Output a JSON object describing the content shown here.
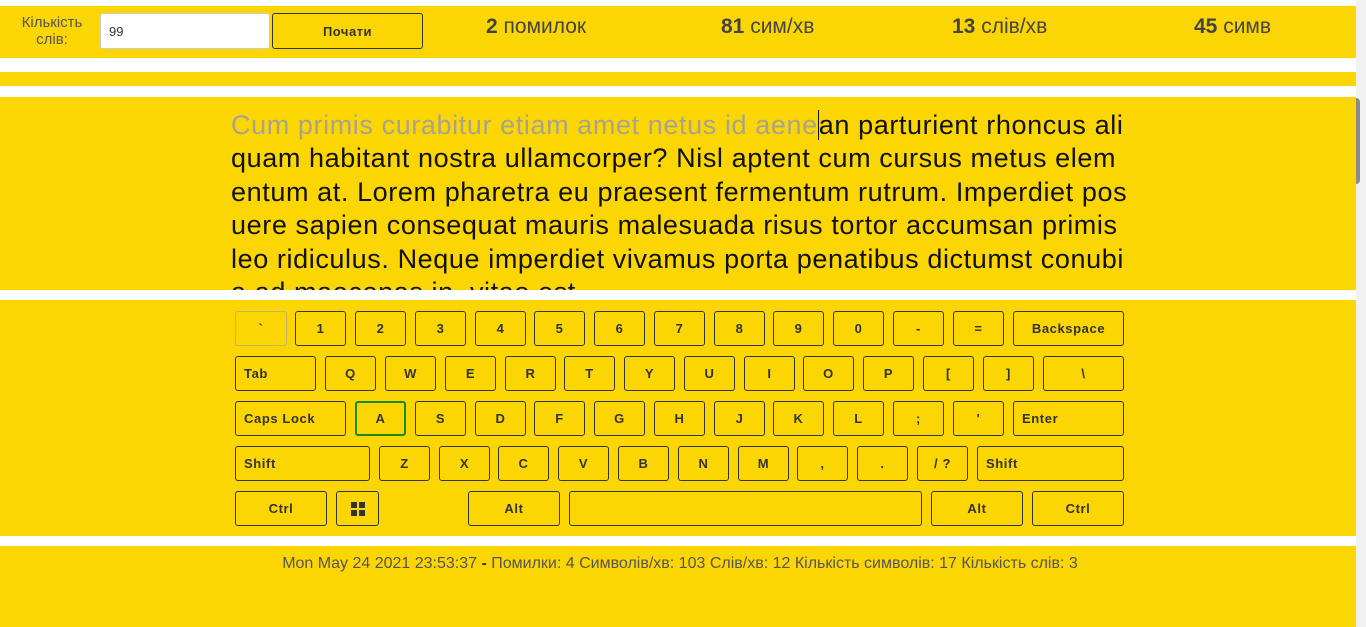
{
  "top_bar": {
    "word_count_label": "Кількість слів:",
    "word_count_value": "99",
    "start_button": "Почати",
    "stats": [
      {
        "value": "2",
        "unit": "помилок"
      },
      {
        "value": "81",
        "unit": "сим/хв"
      },
      {
        "value": "13",
        "unit": "слів/хв"
      },
      {
        "value": "45",
        "unit": "симв"
      }
    ]
  },
  "text": {
    "typed": "Cum primis curabitur etiam amet netus id aene",
    "remaining": "an parturient rhoncus aliquam habitant nostra ullamcorper? Nisl aptent cum cursus metus elementum at. Lorem pharetra eu praesent fermentum rutrum. Imperdiet posuere sapien consequat mauris malesuada risus tortor accumsan primis leo ridiculus. Neque imperdiet vivamus porta penatibus dictumst conubia ad maecenas in, vitae est"
  },
  "keyboard": {
    "active_key": "A",
    "rows": [
      [
        "`",
        "1",
        "2",
        "3",
        "4",
        "5",
        "6",
        "7",
        "8",
        "9",
        "0",
        "-",
        "=",
        "Backspace"
      ],
      [
        "Tab",
        "Q",
        "W",
        "E",
        "R",
        "T",
        "Y",
        "U",
        "I",
        "O",
        "P",
        "[",
        "]",
        "\\"
      ],
      [
        "Caps Lock",
        "A",
        "S",
        "D",
        "F",
        "G",
        "H",
        "J",
        "K",
        "L",
        ";",
        "'",
        "Enter"
      ],
      [
        "Shift",
        "Z",
        "X",
        "C",
        "V",
        "B",
        "N",
        "M",
        ",",
        ".",
        "/ ?",
        "Shift"
      ],
      [
        "Ctrl",
        "windows-icon",
        "Alt",
        "",
        "Alt",
        "Ctrl"
      ]
    ]
  },
  "footer": {
    "timestamp": "Mon May 24 2021 23:53:37",
    "separator": "-",
    "summary": "Помилки: 4 Символів/хв: 103 Слів/хв: 12 Кількість символів: 17 Кількість слів: 3"
  },
  "colors": {
    "background_band": "#fcd602",
    "typed_text": "#a8a390",
    "active_key_border": "#1a8a1a"
  }
}
